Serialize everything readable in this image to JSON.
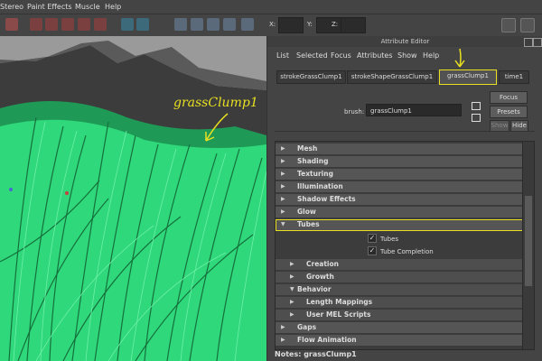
{
  "menubar": {
    "items": [
      "Stereo",
      "Paint Effects",
      "Muscle",
      "Help"
    ]
  },
  "toolbar": {
    "x_label": "X:",
    "y_label": "Y:",
    "z_label": "Z:"
  },
  "viewport": {
    "annotation": "grassClump1"
  },
  "attribute_editor": {
    "title": "Attribute Editor",
    "menu": [
      "List",
      "Selected",
      "Focus",
      "Attributes",
      "Show",
      "Help"
    ],
    "tabs": [
      "strokeGrassClump1",
      "strokeShapeGrassClump1",
      "grassClump1",
      "time1"
    ],
    "active_tab": "grassClump1",
    "brush_label": "brush:",
    "brush_value": "grassClump1",
    "focus_label": "Focus",
    "presets_label": "Presets",
    "show_label": "Show",
    "hide_label": "Hide",
    "sections": [
      {
        "label": "Mesh",
        "expanded": false
      },
      {
        "label": "Shading",
        "expanded": false
      },
      {
        "label": "Texturing",
        "expanded": false
      },
      {
        "label": "Illumination",
        "expanded": false
      },
      {
        "label": "Shadow Effects",
        "expanded": false
      },
      {
        "label": "Glow",
        "expanded": false
      },
      {
        "label": "Tubes",
        "expanded": true
      },
      {
        "label": "Creation",
        "expanded": false
      },
      {
        "label": "Growth",
        "expanded": false
      },
      {
        "label": "Behavior",
        "expanded": true
      },
      {
        "label": "Length Mappings",
        "expanded": false
      },
      {
        "label": "User MEL Scripts",
        "expanded": false
      },
      {
        "label": "Gaps",
        "expanded": false
      },
      {
        "label": "Flow Animation",
        "expanded": false
      }
    ],
    "checkboxes": [
      {
        "label": "Tubes",
        "checked": true
      },
      {
        "label": "Tube Completion",
        "checked": true
      }
    ],
    "notes_label": "Notes:",
    "notes_value": "grassClump1"
  },
  "colors": {
    "highlight": "#e8e020",
    "grass": "#2fd87a"
  }
}
